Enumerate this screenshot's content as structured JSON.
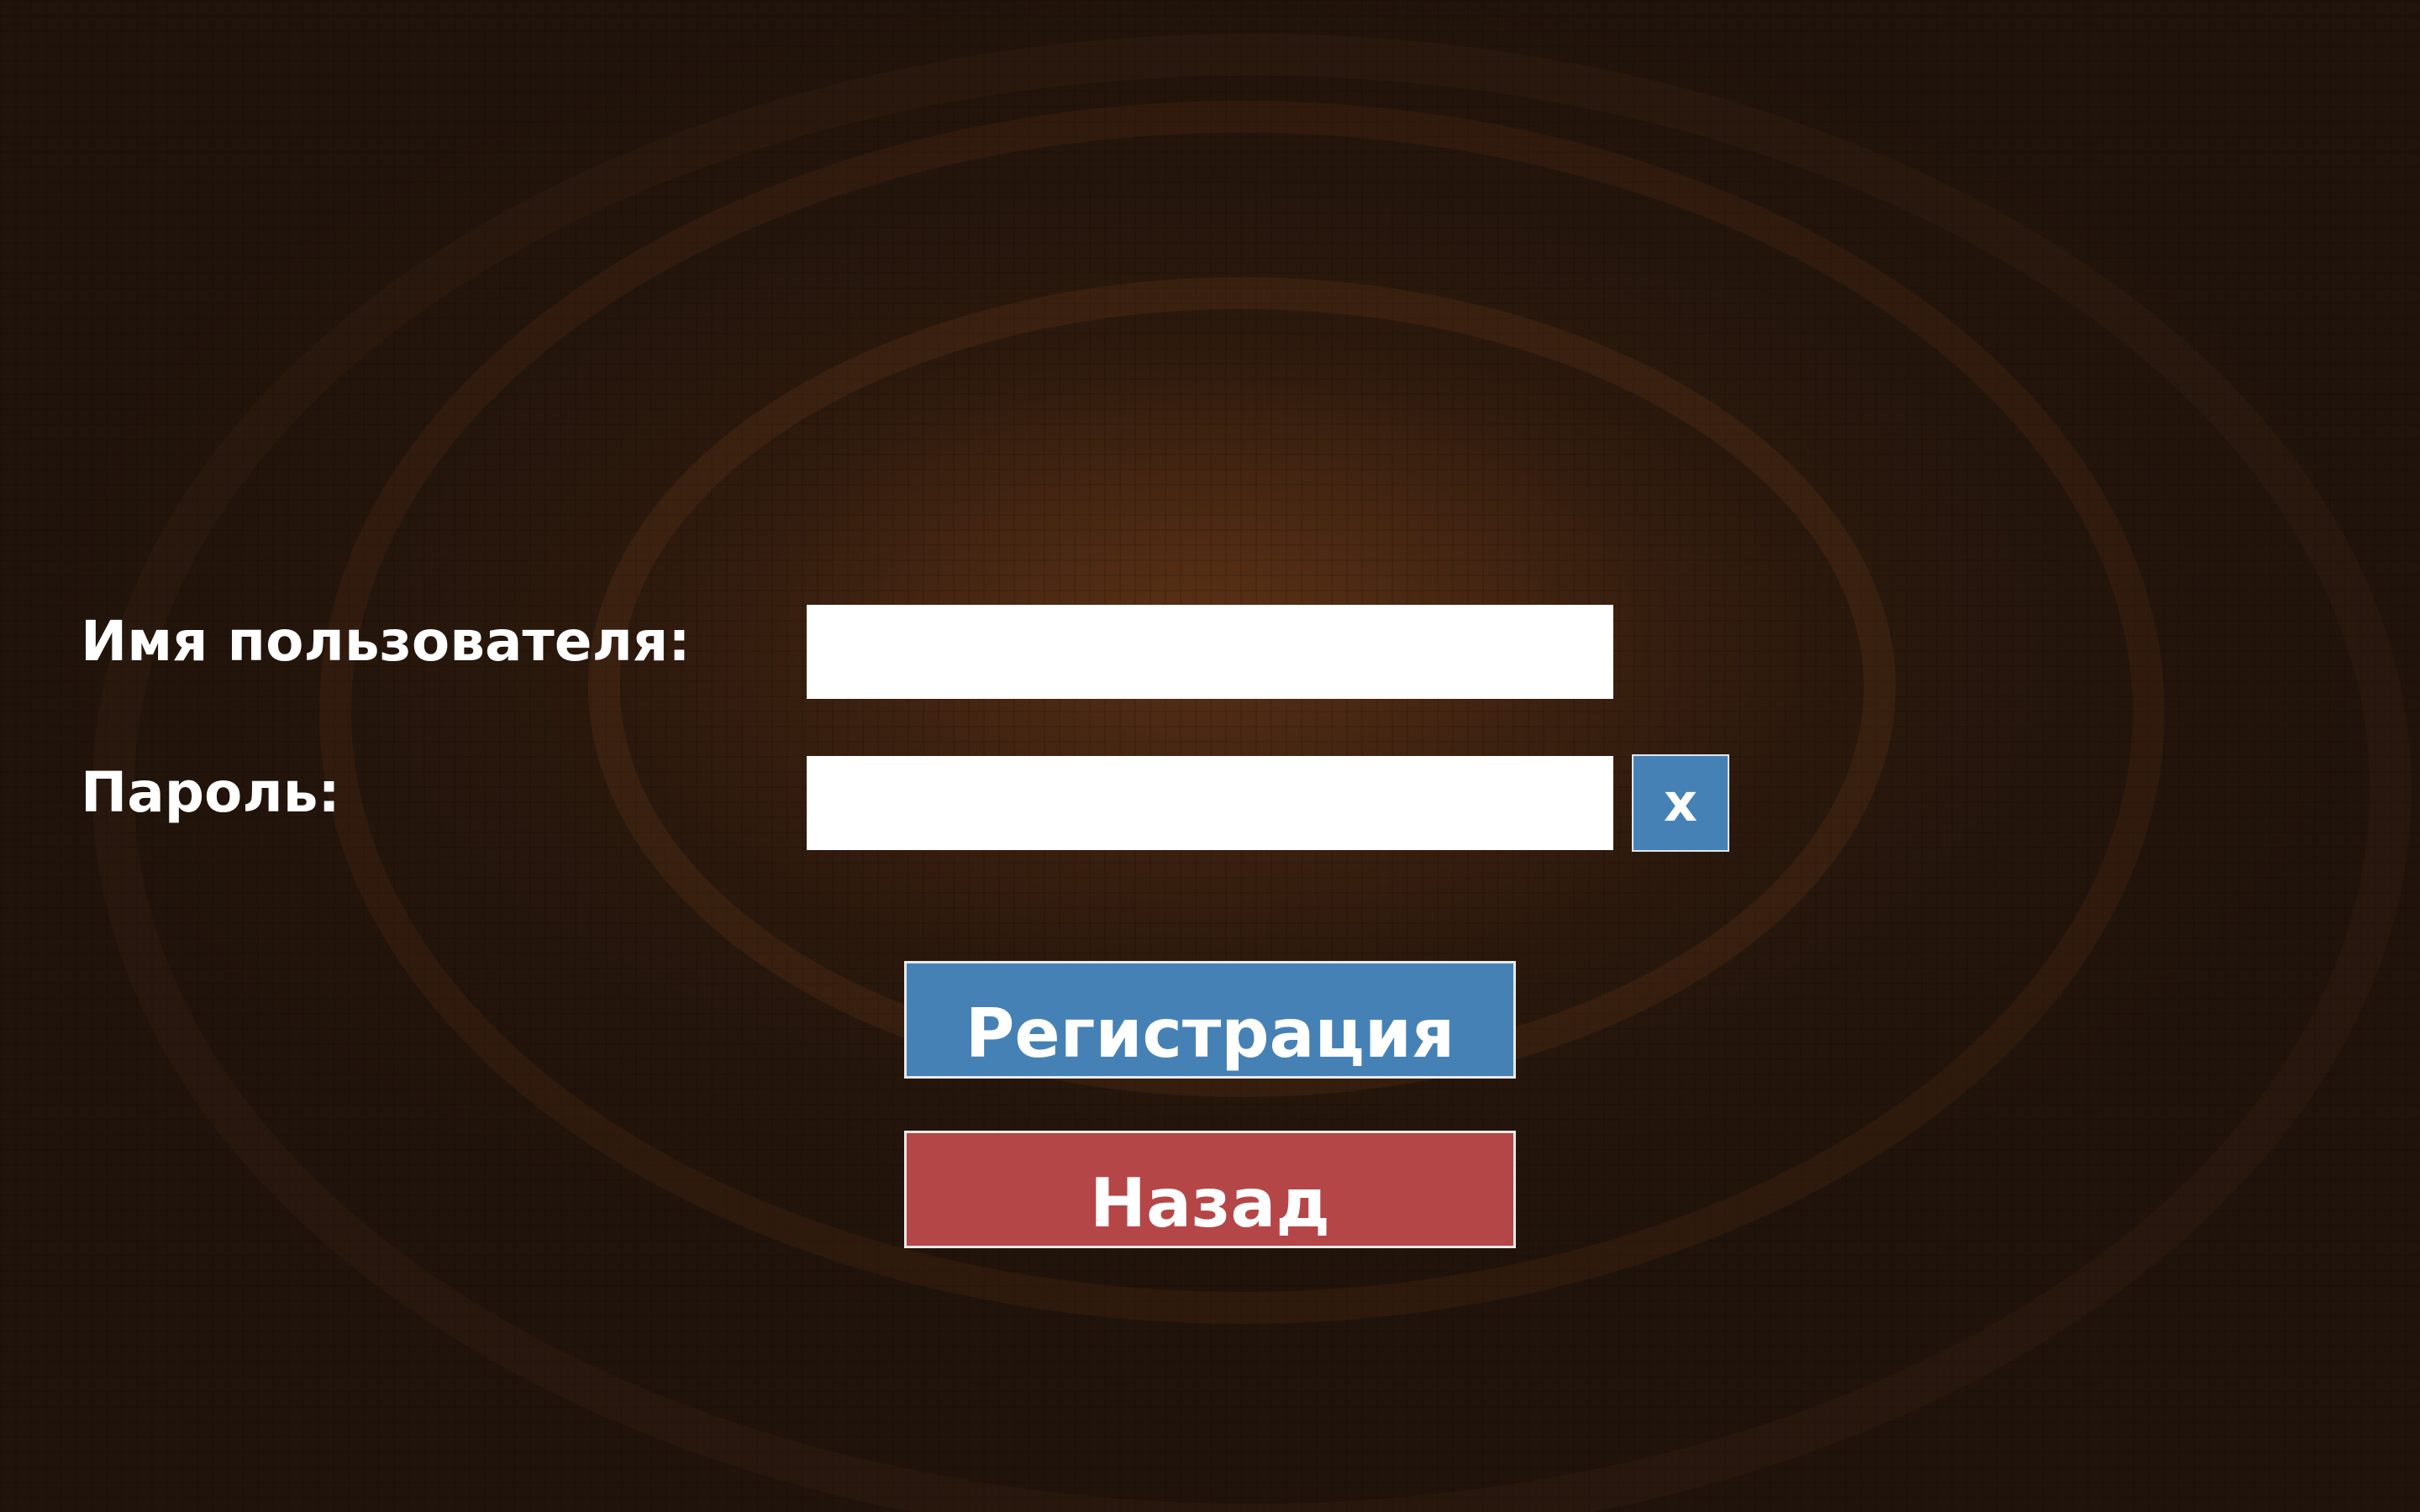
{
  "form": {
    "username_label": "Имя пользователя:",
    "password_label": "Пароль:",
    "username_value": "",
    "password_value": "",
    "clear_label": "x"
  },
  "actions": {
    "register_label": "Регистрация",
    "back_label": "Назад"
  },
  "colors": {
    "background": "#20130b",
    "primary_button": "#4681b6",
    "danger_button": "#b54647",
    "text": "#ffffff",
    "field": "#ffffff"
  },
  "icons": {
    "clear": "clear-password-icon"
  }
}
